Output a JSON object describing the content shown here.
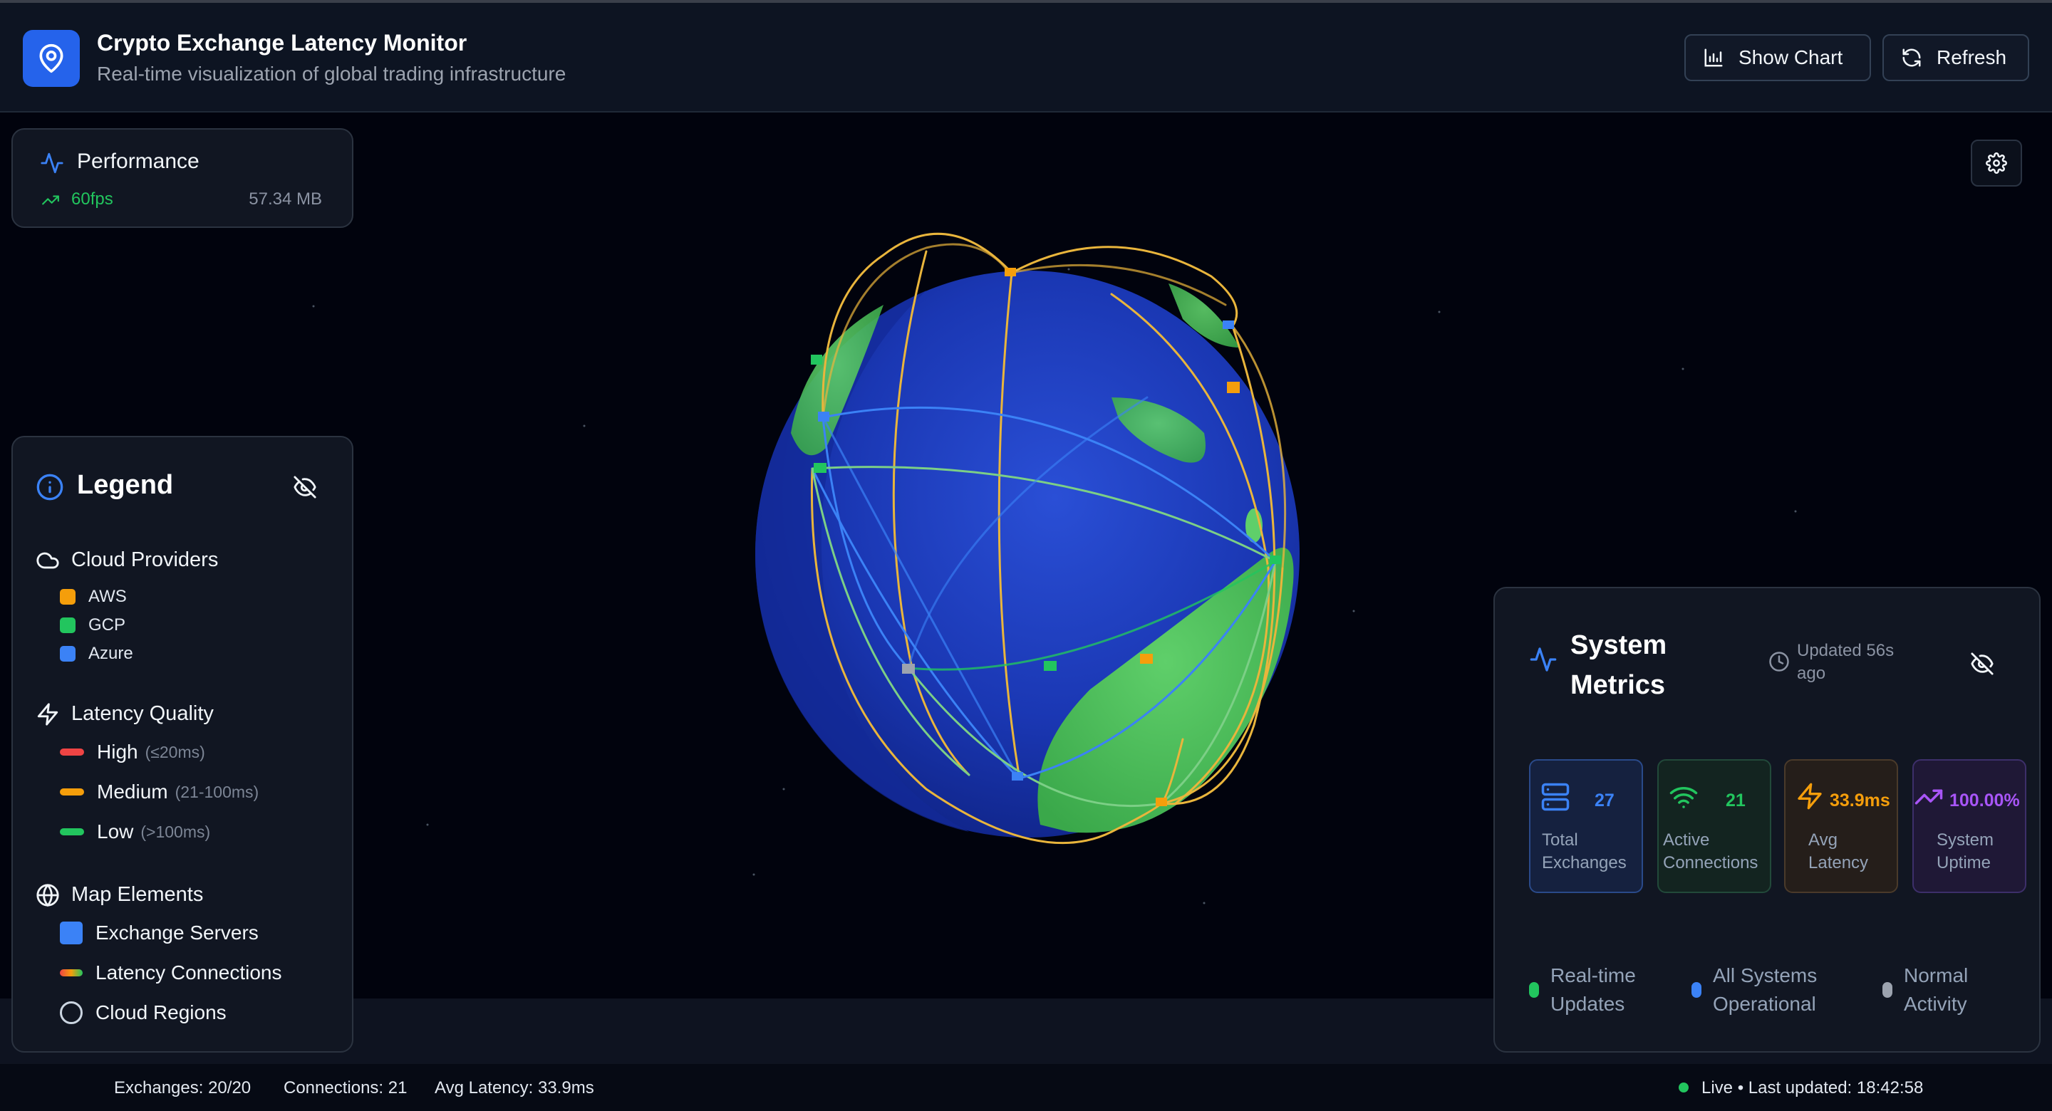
{
  "header": {
    "title": "Crypto Exchange Latency Monitor",
    "subtitle": "Real-time visualization of global trading infrastructure",
    "show_chart_label": "Show Chart",
    "refresh_label": "Refresh",
    "logo_icon": "map-pin-icon"
  },
  "performance": {
    "title": "Performance",
    "fps": "60fps",
    "memory": "57.34 MB"
  },
  "legend": {
    "title": "Legend",
    "cloud_providers": {
      "title": "Cloud Providers",
      "items": [
        {
          "label": "AWS",
          "color": "#f59e0b"
        },
        {
          "label": "GCP",
          "color": "#22c55e"
        },
        {
          "label": "Azure",
          "color": "#3b82f6"
        }
      ]
    },
    "latency_quality": {
      "title": "Latency Quality",
      "items": [
        {
          "label": "High",
          "range": "(≤20ms)",
          "color": "#ef4444"
        },
        {
          "label": "Medium",
          "range": "(21-100ms)",
          "color": "#f59e0b"
        },
        {
          "label": "Low",
          "range": "(>100ms)",
          "color": "#22c55e"
        }
      ]
    },
    "map_elements": {
      "title": "Map Elements",
      "items": [
        {
          "label": "Exchange Servers"
        },
        {
          "label": "Latency Connections"
        },
        {
          "label": "Cloud Regions"
        }
      ]
    }
  },
  "metrics": {
    "title": "System Metrics",
    "updated": "Updated 56s ago",
    "cards": [
      {
        "value": "27",
        "label": "Total Exchanges",
        "color": "#3b82f6"
      },
      {
        "value": "21",
        "label": "Active Connections",
        "color": "#22c55e"
      },
      {
        "value": "33.9ms",
        "label": "Avg Latency",
        "color": "#f59e0b"
      },
      {
        "value": "100.00%",
        "label": "System Uptime",
        "color": "#a855f7"
      }
    ],
    "status": [
      {
        "label": "Real-time Updates",
        "color": "#22c55e"
      },
      {
        "label": "All Systems Operational",
        "color": "#3b82f6"
      },
      {
        "label": "Normal Activity",
        "color": "#9ca3af"
      }
    ]
  },
  "footer": {
    "exchanges": "Exchanges: 20/20",
    "connections": "Connections: 21",
    "avg_latency": "Avg Latency: 33.9ms",
    "live": "Live • Last updated: 18:42:58"
  }
}
